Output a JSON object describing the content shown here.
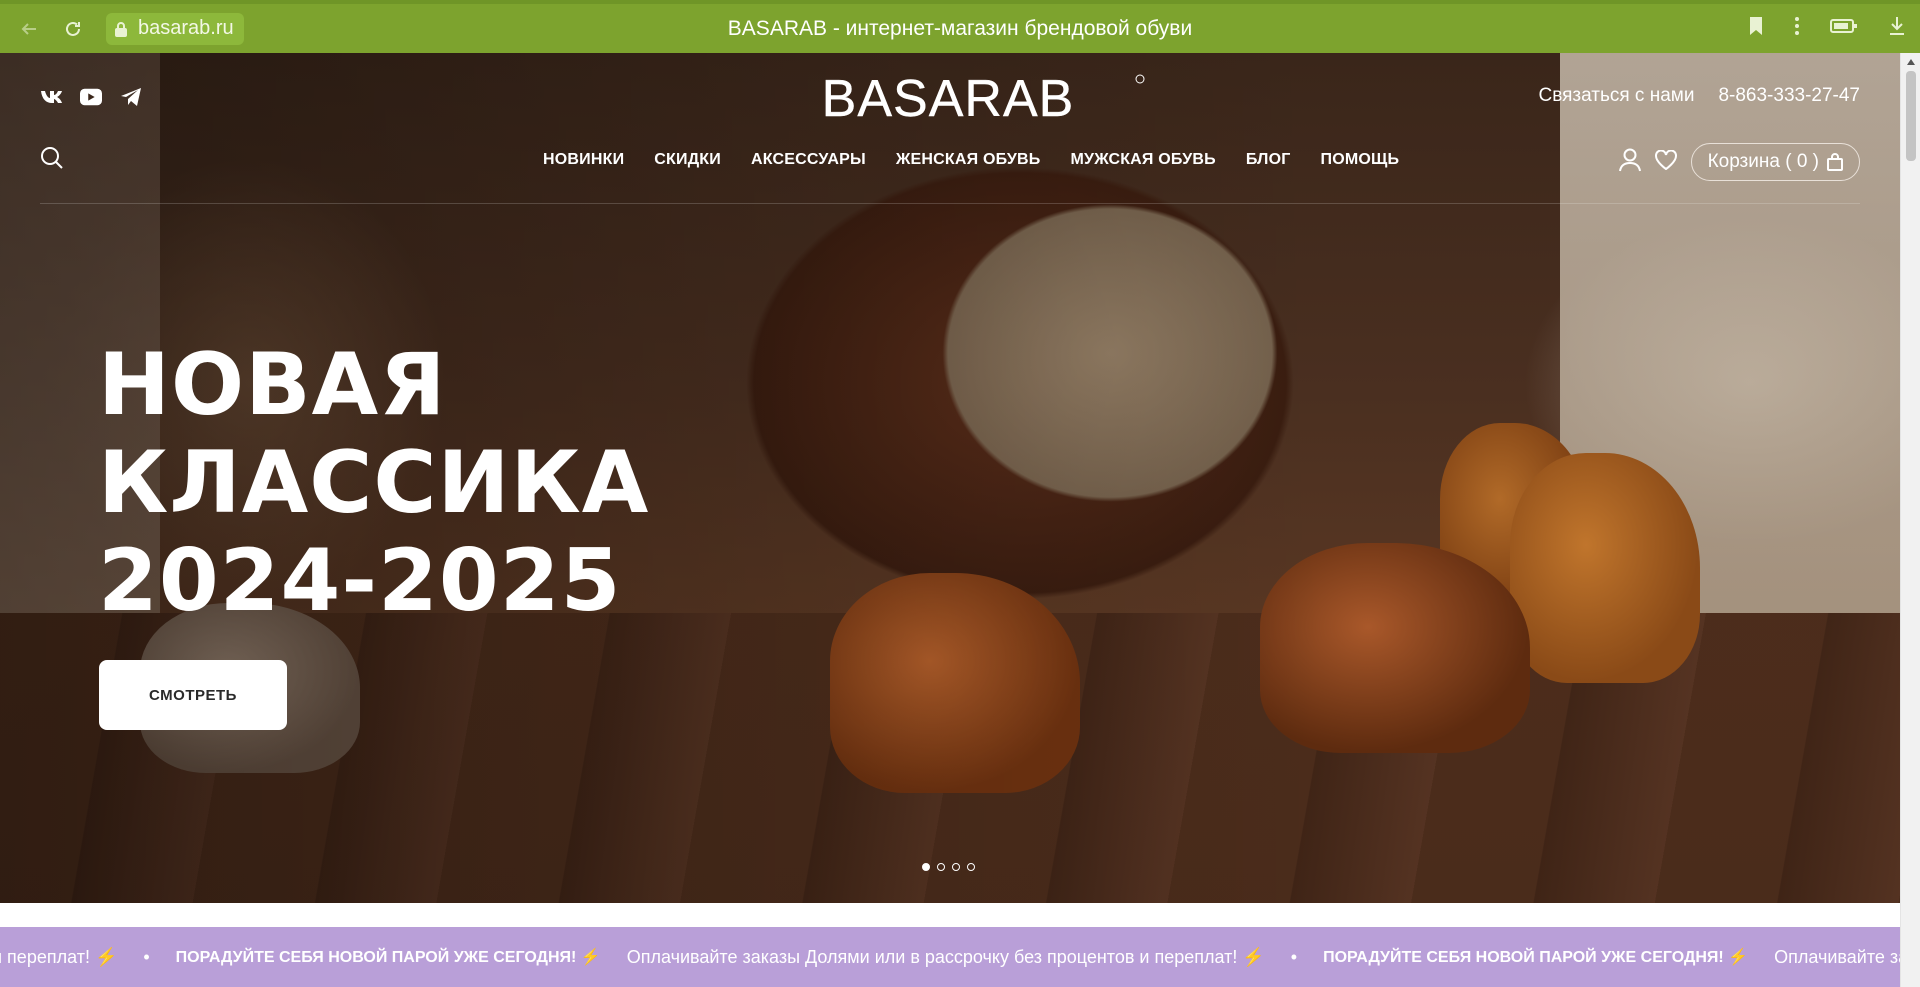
{
  "browser": {
    "url": "basarab.ru",
    "tab_title": "BASARAB - интернет-магазин брендовой обуви"
  },
  "header": {
    "brand": "BASARAB",
    "contact_label": "Связаться с нами",
    "phone": "8-863-333-27-47",
    "cart_label": "Корзина ( 0 )",
    "menu": [
      "НОВИНКИ",
      "СКИДКИ",
      "АКСЕССУАРЫ",
      "ЖЕНСКАЯ ОБУВЬ",
      "МУЖСКАЯ ОБУВЬ",
      "БЛОГ",
      "ПОМОЩЬ"
    ],
    "social": [
      "vk-icon",
      "youtube-icon",
      "telegram-icon"
    ]
  },
  "hero": {
    "line1": "НОВАЯ",
    "line2": "КЛАССИКА",
    "line3": "2024-2025",
    "button": "СМОТРЕТЬ",
    "slides": 4,
    "active_slide": 1
  },
  "ticker": {
    "items": [
      "и переплат! ⚡",
      "•",
      "ПОРАДУЙТЕ СЕБЯ НОВОЙ ПАРОЙ УЖЕ СЕГОДНЯ! ⚡",
      "Оплачивайте заказы Долями или в рассрочку без процентов и переплат! ⚡",
      "•",
      "ПОРАДУЙТЕ СЕБЯ НОВОЙ ПАРОЙ УЖЕ СЕГОДНЯ! ⚡",
      "Оплачивайте заказ"
    ]
  },
  "colors": {
    "browser_bar": "#7da32e",
    "ticker_bg": "#b99fd8"
  }
}
